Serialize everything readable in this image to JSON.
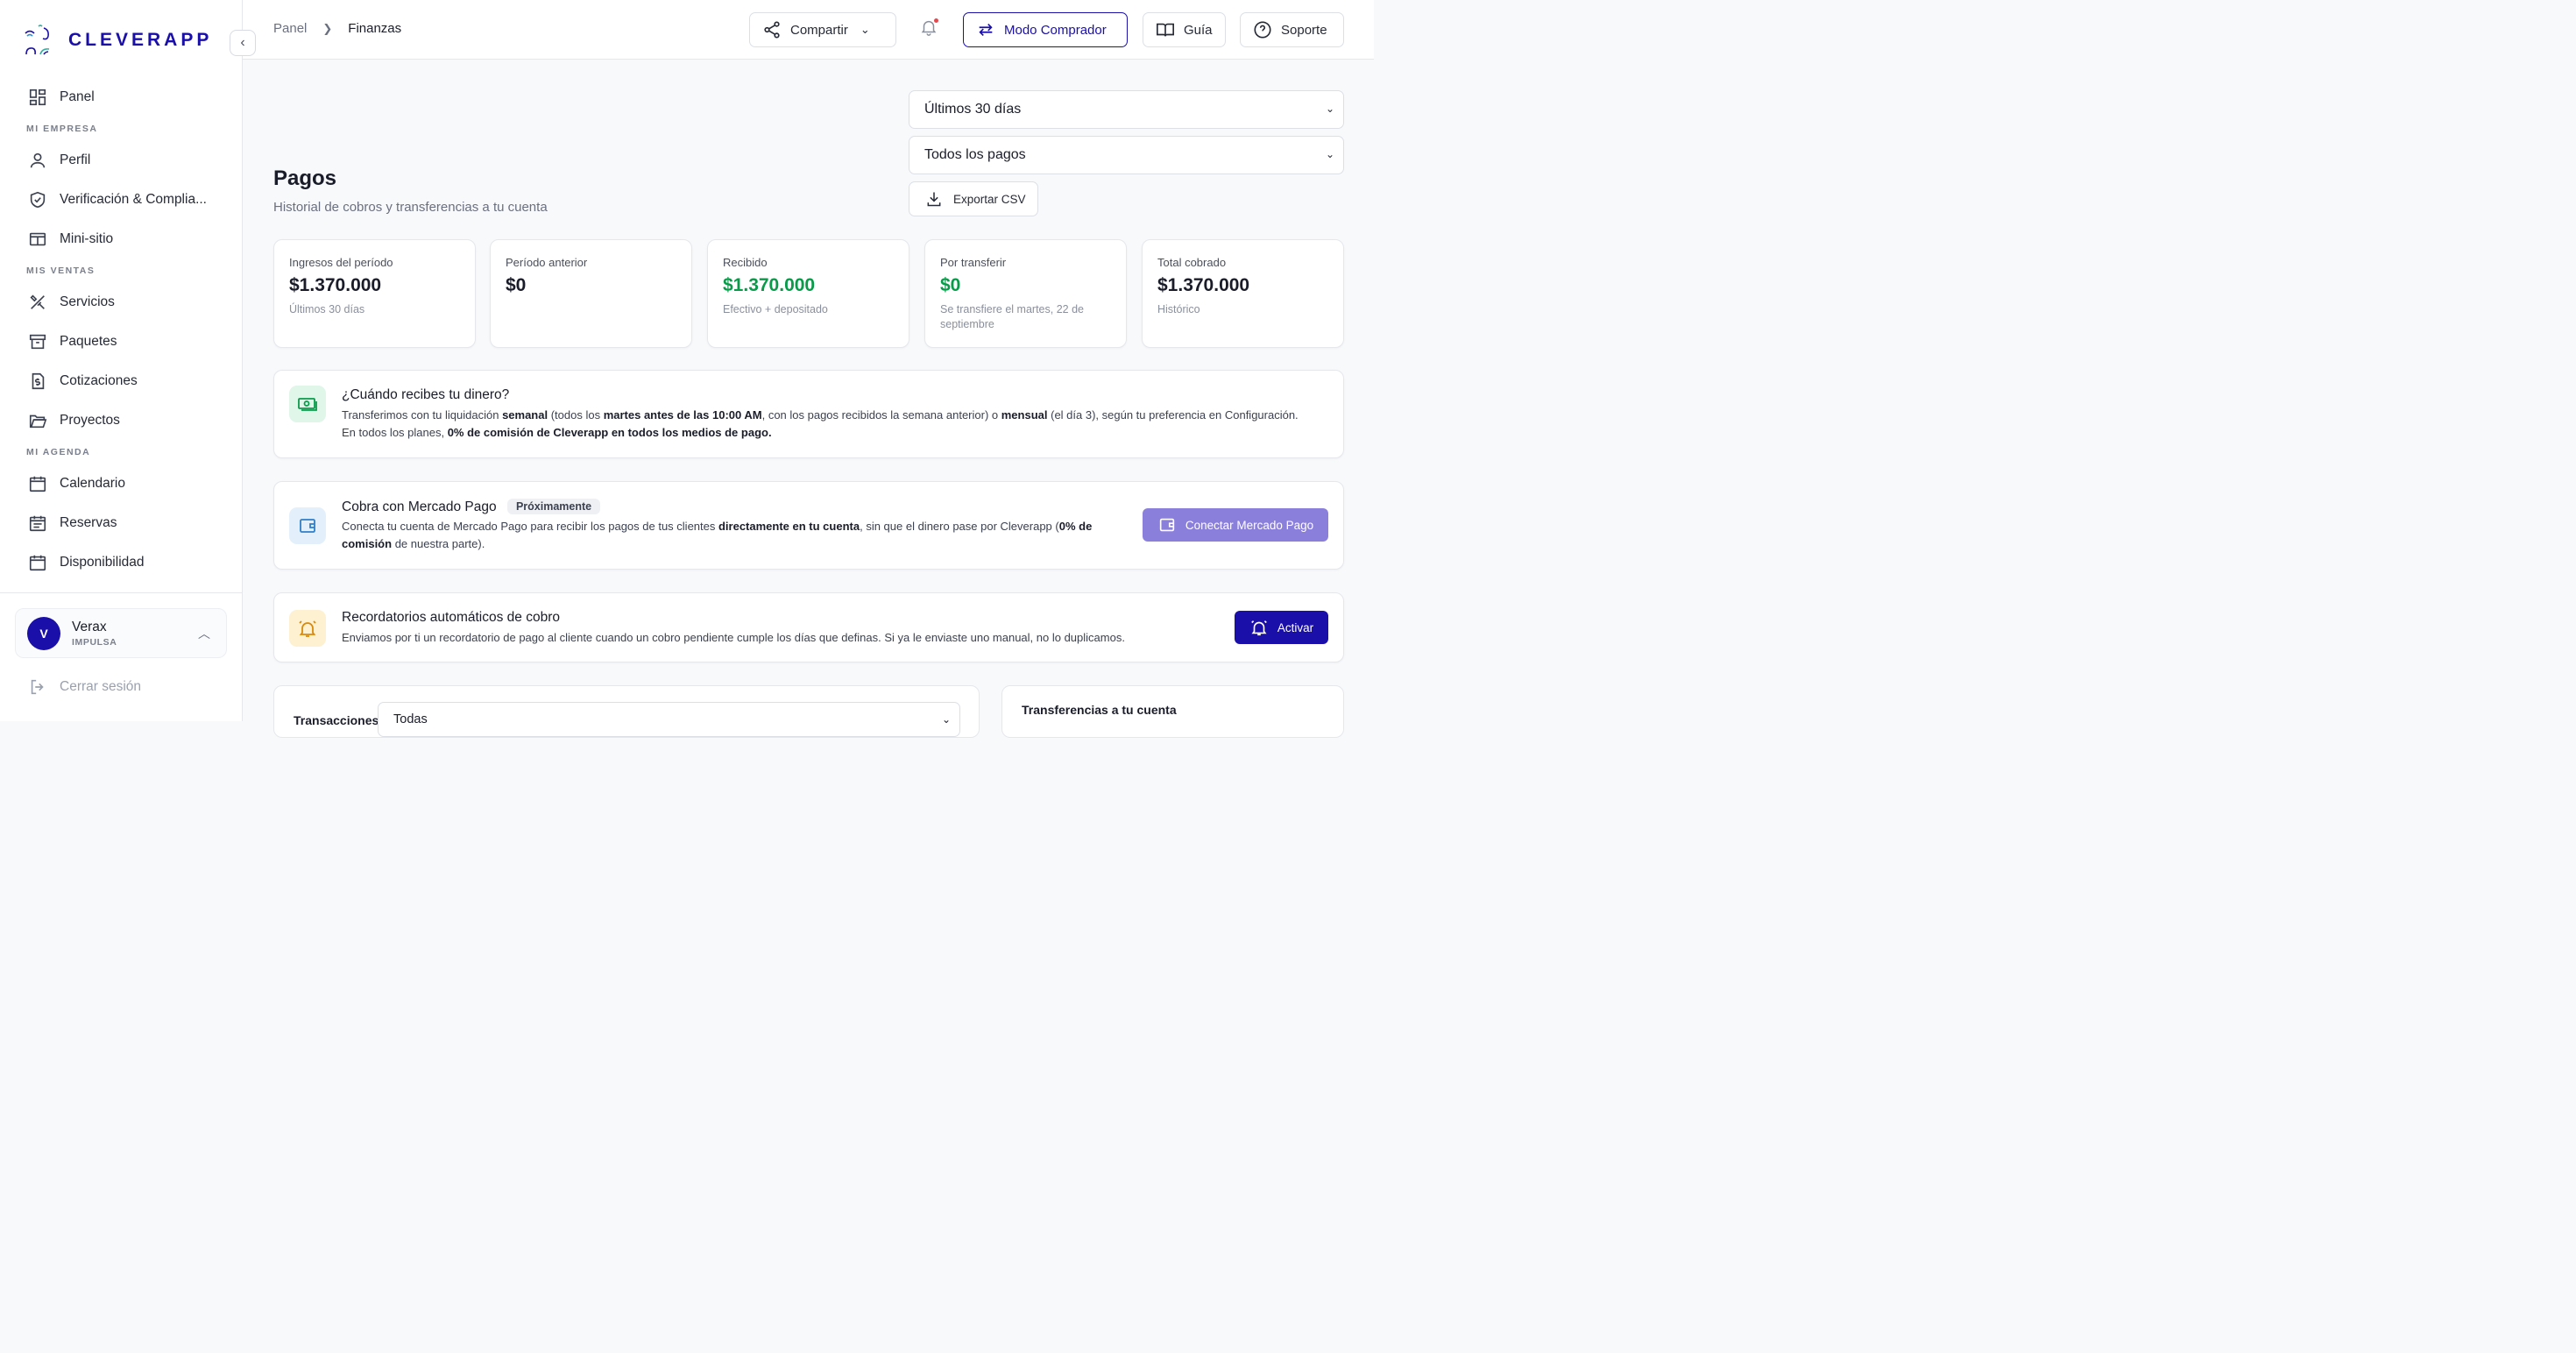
{
  "brand": {
    "name": "CLEVERAPP",
    "accent": "#1a0fa8"
  },
  "sidebar": {
    "items": [
      {
        "type": "item",
        "label": "Panel",
        "icon": "dashboard-icon"
      },
      {
        "type": "section",
        "label": "MI EMPRESA"
      },
      {
        "type": "item",
        "label": "Perfil",
        "icon": "user-icon"
      },
      {
        "type": "item",
        "label": "Verificación & Complia...",
        "icon": "shield-check-icon"
      },
      {
        "type": "item",
        "label": "Mini-sitio",
        "icon": "browser-window-icon"
      },
      {
        "type": "section",
        "label": "MIS VENTAS"
      },
      {
        "type": "item",
        "label": "Servicios",
        "icon": "tools-icon"
      },
      {
        "type": "item",
        "label": "Paquetes",
        "icon": "archive-box-icon"
      },
      {
        "type": "item",
        "label": "Cotizaciones",
        "icon": "invoice-dollar-icon"
      },
      {
        "type": "item",
        "label": "Proyectos",
        "icon": "folder-open-icon"
      },
      {
        "type": "section",
        "label": "MI AGENDA"
      },
      {
        "type": "item",
        "label": "Calendario",
        "icon": "calendar-icon"
      },
      {
        "type": "item",
        "label": "Reservas",
        "icon": "calendar-list-icon"
      },
      {
        "type": "item",
        "label": "Disponibilidad",
        "icon": "calendar-clock-icon"
      }
    ],
    "user": {
      "initial": "V",
      "name": "Verax",
      "plan": "IMPULSA"
    },
    "logout_label": "Cerrar sesión"
  },
  "topbar": {
    "breadcrumb": [
      "Panel",
      "Finanzas"
    ],
    "share_label": "Compartir",
    "buyer_mode_label": "Modo Comprador",
    "guide_label": "Guía",
    "support_label": "Soporte"
  },
  "filters": {
    "period": "Últimos 30 días",
    "payment_type": "Todos los pagos",
    "export_label": "Exportar CSV"
  },
  "page": {
    "title": "Pagos",
    "subtitle": "Historial de cobros y transferencias a tu cuenta"
  },
  "stats": [
    {
      "label": "Ingresos del período",
      "value": "$1.370.000",
      "sub": "Últimos 30 días",
      "green": false
    },
    {
      "label": "Período anterior",
      "value": "$0",
      "sub": "",
      "green": false
    },
    {
      "label": "Recibido",
      "value": "$1.370.000",
      "sub": "Efectivo + depositado",
      "green": true
    },
    {
      "label": "Por transferir",
      "value": "$0",
      "sub": "Se transfiere el martes, 22 de septiembre",
      "green": true
    },
    {
      "label": "Total cobrado",
      "value": "$1.370.000",
      "sub": "Histórico",
      "green": false
    }
  ],
  "info_payout": {
    "title": "¿Cuándo recibes tu dinero?",
    "t1": "Transferimos con tu liquidación ",
    "b1": "semanal",
    "t2": " (todos los ",
    "b2": "martes antes de las 10:00 AM",
    "t3": ", con los pagos recibidos la semana anterior) o ",
    "b3": "mensual",
    "t4": " (el día 3), según tu preferencia en Configuración. En todos los planes, ",
    "b4": "0% de comisión de Cleverapp en todos los medios de pago."
  },
  "mercado_pago": {
    "title": "Cobra con Mercado Pago",
    "badge": "Próximamente",
    "t1": "Conecta tu cuenta de Mercado Pago para recibir los pagos de tus clientes ",
    "b1": "directamente en tu cuenta",
    "t2": ", sin que el dinero pase por Cleverapp (",
    "b2": "0% de comisión",
    "t3": " de nuestra parte).",
    "button": "Conectar Mercado Pago"
  },
  "reminders": {
    "title": "Recordatorios automáticos de cobro",
    "body": "Enviamos por ti un recordatorio de pago al cliente cuando un cobro pendiente cumple los días que definas. Si ya le enviaste uno manual, no lo duplicamos.",
    "button": "Activar"
  },
  "transactions": {
    "title": "Transacciones",
    "filter": "Todas"
  },
  "transfers": {
    "title": "Transferencias a tu cuenta"
  }
}
